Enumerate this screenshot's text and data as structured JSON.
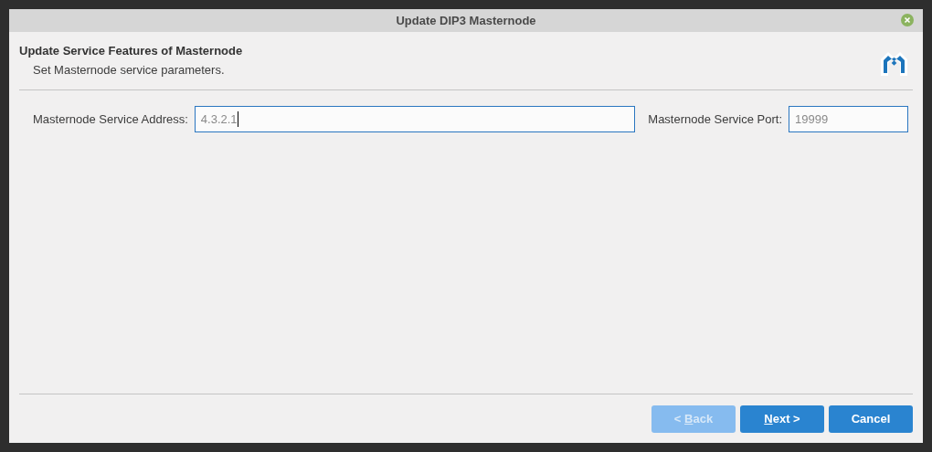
{
  "window": {
    "title": "Update DIP3 Masternode"
  },
  "header": {
    "title": "Update Service Features of Masternode",
    "subtitle": "Set Masternode service parameters."
  },
  "fields": [
    {
      "label": "Masternode Service Address:",
      "value": "4.3.2.1",
      "cursor": true
    },
    {
      "label": "Masternode Service Port:",
      "value": "19999",
      "cursor": false
    }
  ],
  "buttons": [
    {
      "before": "< ",
      "mnemonic": "B",
      "after": "ack",
      "disabled": true
    },
    {
      "mnemonic": "N",
      "after": "ext >",
      "disabled": false
    },
    {
      "before": "Cancel",
      "disabled": false
    }
  ]
}
